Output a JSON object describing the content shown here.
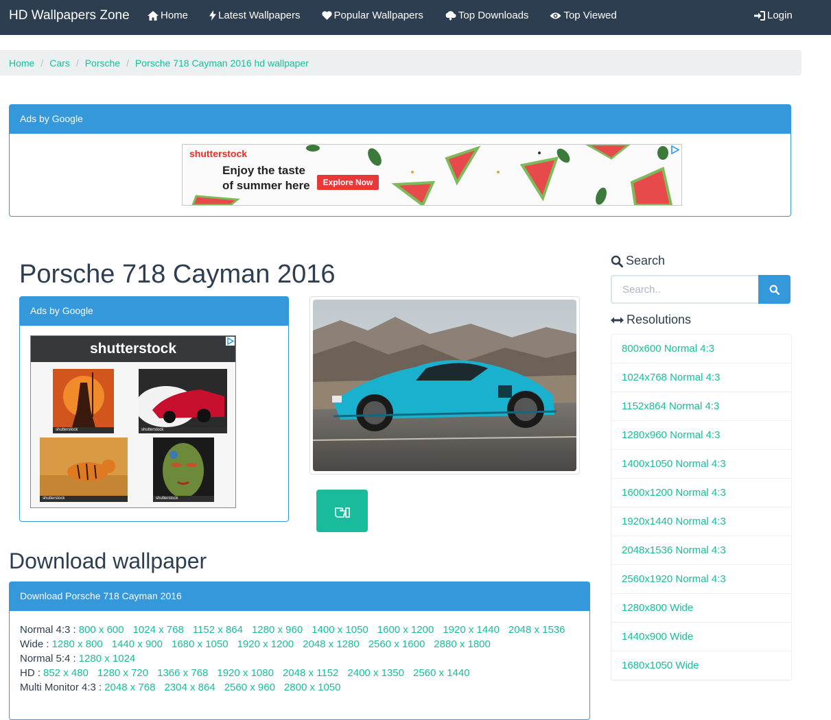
{
  "navbar": {
    "brand": "HD Wallpapers Zone",
    "items": [
      {
        "label": "Home",
        "icon": "home-icon"
      },
      {
        "label": "Latest Wallpapers",
        "icon": "bolt-icon"
      },
      {
        "label": "Popular Wallpapers",
        "icon": "heart-icon"
      },
      {
        "label": "Top Downloads",
        "icon": "cloud-download-icon"
      },
      {
        "label": "Top Viewed",
        "icon": "eye-icon"
      }
    ],
    "login": "Login"
  },
  "breadcrumb": [
    "Home",
    "Cars",
    "Porsche",
    "Porsche 718 Cayman 2016 hd wallpaper"
  ],
  "ad_top": {
    "heading": "Ads by Google",
    "banner": {
      "brand": "shutterstock",
      "line1": "Enjoy the taste",
      "line2": "of summer here",
      "cta": "Explore Now"
    }
  },
  "title": "Porsche 718 Cayman 2016",
  "ad_left": {
    "heading": "Ads by Google",
    "brand": "shutterstock",
    "thumb_caption": "shutterstock"
  },
  "download": {
    "title": "Download wallpaper",
    "panel_heading": "Download Porsche 718 Cayman 2016",
    "rows": [
      {
        "label": "Normal 4:3 :",
        "sizes": [
          "800 x 600",
          "1024 x 768",
          "1152 x 864",
          "1280 x 960",
          "1400 x 1050",
          "1600 x 1200",
          "1920 x 1440",
          "2048 x 1536"
        ]
      },
      {
        "label": "Wide :",
        "sizes": [
          "1280 x 800",
          "1440 x 900",
          "1680 x 1050",
          "1920 x 1200",
          "2048 x 1280",
          "2560 x 1600",
          "2880 x 1800"
        ]
      },
      {
        "label": "Normal 5:4 :",
        "sizes": [
          "1280 x 1024"
        ]
      },
      {
        "label": "HD :",
        "sizes": [
          "852 x 480",
          "1280 x 720",
          "1366 x 768",
          "1920 x 1080",
          "2048 x 1152",
          "2400 x 1350",
          "2560 x 1440"
        ]
      },
      {
        "label": "Multi Monitor 4:3 :",
        "sizes": [
          "2048 x 768",
          "2304 x 864",
          "2560 x 960",
          "2800 x 1050"
        ]
      }
    ]
  },
  "sidebar": {
    "search_heading": "Search",
    "search_placeholder": "Search..",
    "resolutions_heading": "Resolutions",
    "resolutions": [
      "800x600 Normal 4:3",
      "1024x768 Normal 4:3",
      "1152x864 Normal 4:3",
      "1280x960 Normal 4:3",
      "1400x1050 Normal 4:3",
      "1600x1200 Normal 4:3",
      "1920x1440 Normal 4:3",
      "2048x1536 Normal 4:3",
      "2560x1920 Normal 4:3",
      "1280x800 Wide",
      "1440x900 Wide",
      "1680x1050 Wide"
    ]
  },
  "colors": {
    "navbar": "#2c3e50",
    "accent": "#18bc9c",
    "panel": "#3498db",
    "breadcrumb_bg": "#ecf0f1"
  }
}
